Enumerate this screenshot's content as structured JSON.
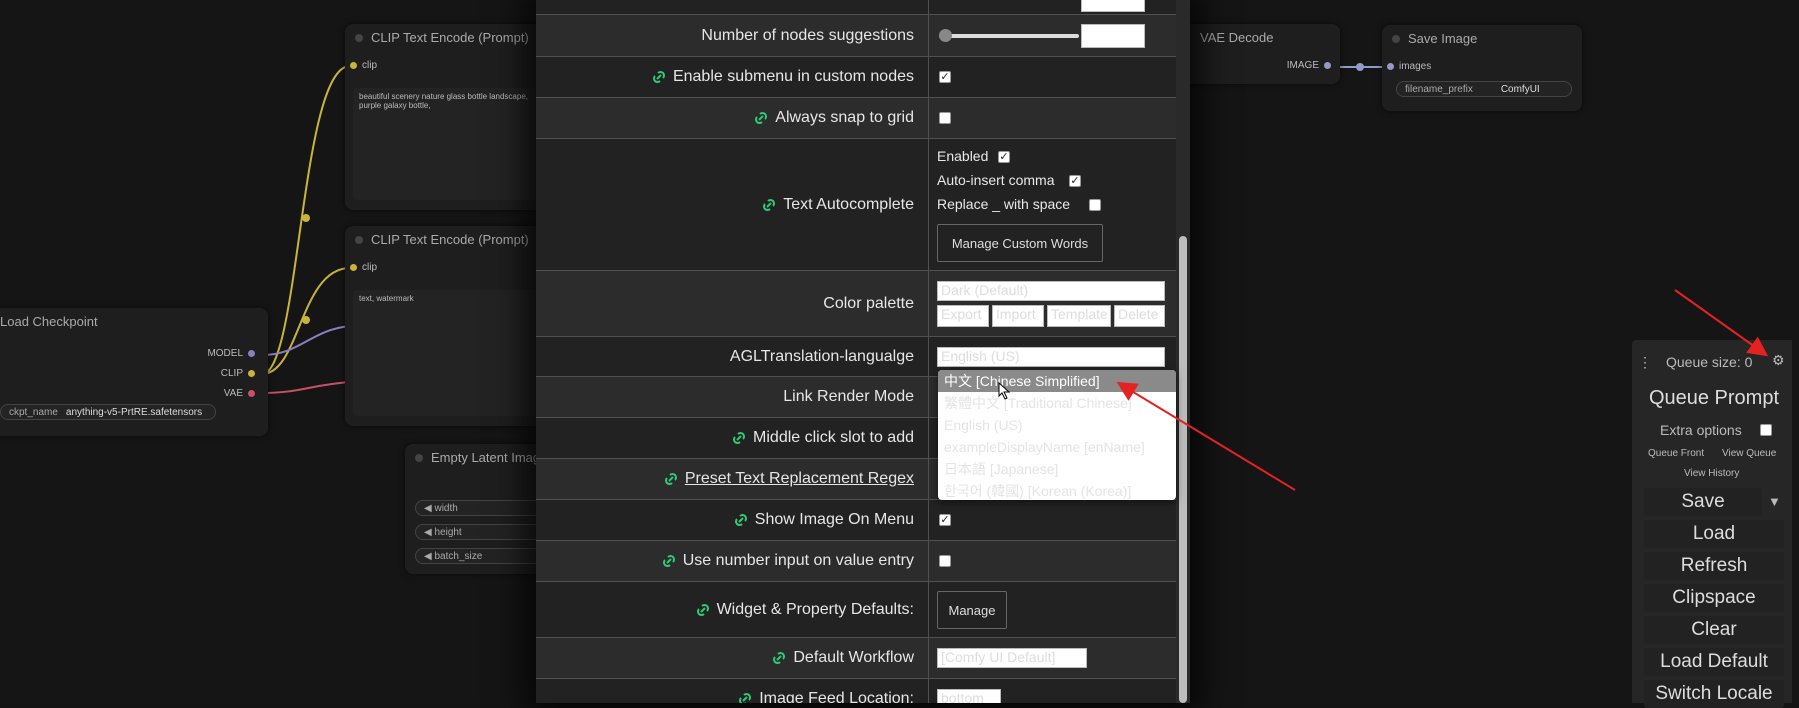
{
  "settings": {
    "number_of_nodes_suggestions": {
      "label": "Number of nodes suggestions",
      "value": ""
    },
    "enable_submenu": {
      "label": "Enable submenu in custom nodes",
      "checked": true
    },
    "always_snap": {
      "label": "Always snap to grid",
      "checked": false
    },
    "text_autocomplete": {
      "label": "Text Autocomplete",
      "enabled_label": "Enabled",
      "enabled": true,
      "auto_comma_label": "Auto-insert comma",
      "auto_comma": true,
      "replace_label": "Replace _ with space",
      "replace": false,
      "manage_button": "Manage Custom Words"
    },
    "color_palette": {
      "label": "Color palette",
      "selected": "Dark (Default)",
      "buttons": [
        "Export",
        "Import",
        "Template",
        "Delete"
      ]
    },
    "agl_translation": {
      "label": "AGLTranslation-langualge",
      "selected": "English (US)"
    },
    "link_render_mode": {
      "label": "Link Render Mode"
    },
    "middle_click": {
      "label": "Middle click slot to add"
    },
    "preset_text": {
      "label": "Preset Text Replacement Regex"
    },
    "show_image_on_menu": {
      "label": "Show Image On Menu",
      "checked": true
    },
    "use_number_input": {
      "label": "Use number input on value entry",
      "checked": false
    },
    "widget_defaults": {
      "label": "Widget & Property Defaults:",
      "button": "Manage"
    },
    "default_workflow": {
      "label": "Default Workflow",
      "value": "[Comfy UI Default]"
    },
    "image_feed_location": {
      "label": "Image Feed Location:",
      "value": "bottom"
    }
  },
  "dropdown": {
    "options": [
      "中文 [Chinese Simplified]",
      "繁體中文 [Traditional Chinese]",
      "English (US)",
      "exampleDisplayName [enName]",
      "日本語 [Japanese]",
      "한국어 (韓國) [Korean (Korea)]"
    ],
    "selected_index": 0
  },
  "nodes": {
    "clip1": {
      "title": "CLIP Text Encode (Prompt)",
      "input": "clip",
      "text": "beautiful scenery nature glass bottle landscape, purple galaxy bottle,"
    },
    "clip2": {
      "title": "CLIP Text Encode (Prompt)",
      "input": "clip",
      "text": "text, watermark"
    },
    "checkpoint": {
      "title": "Load Checkpoint",
      "out_model": "MODEL",
      "out_clip": "CLIP",
      "out_vae": "VAE",
      "widget_label": "ckpt_name",
      "widget_value": "anything-v5-PrtRE.safetensors"
    },
    "latent": {
      "title": "Empty Latent Image",
      "w1": "width",
      "w2": "height",
      "w3": "batch_size"
    },
    "vae_decode": {
      "title": "VAE Decode",
      "out": "IMAGE"
    },
    "save": {
      "title": "Save Image",
      "input": "images",
      "widget_label": "filename_prefix",
      "widget_value": "ComfyUI"
    }
  },
  "queue": {
    "size_label": "Queue size: 0",
    "prompt_button": "Queue Prompt",
    "extra_options": "Extra options",
    "queue_front": "Queue Front",
    "view_queue": "View Queue",
    "view_history": "View History",
    "buttons": [
      "Save",
      "Load",
      "Refresh",
      "Clipspace",
      "Clear",
      "Load Default",
      "Switch Locale"
    ]
  },
  "colors": {
    "link_icon": "#2ecc71",
    "wire_yellow": "#c9b43b",
    "wire_purple": "#8b7fc0",
    "wire_red": "#c85069",
    "arrow": "#e52222"
  }
}
